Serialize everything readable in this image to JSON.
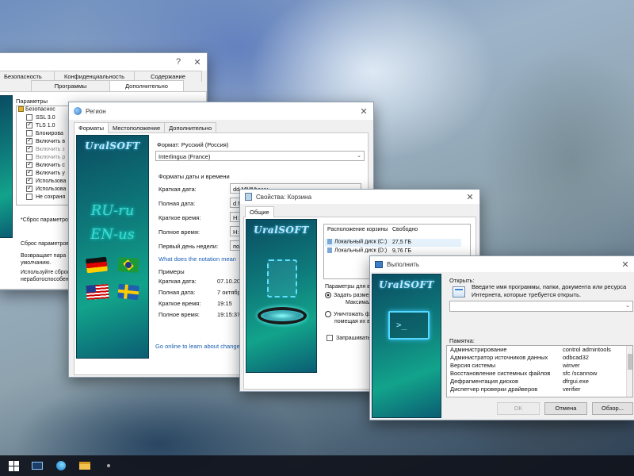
{
  "inet_window": {
    "help": "?",
    "close": "✕",
    "tabs_row1": [
      "Безопасность",
      "Конфиденциальность",
      "Содержание"
    ],
    "tabs_row2": [
      "Программы",
      "Дополнительно"
    ],
    "params_label": "Параметры",
    "tree": [
      {
        "label": "Безопаснос",
        "type": "folder"
      },
      {
        "label": "SSL 3.0",
        "checked": false
      },
      {
        "label": "TLS 1.0",
        "checked": true
      },
      {
        "label": "Блокирова",
        "checked": false
      },
      {
        "label": "Включить в",
        "checked": true
      },
      {
        "label": "Включить з",
        "checked": true
      },
      {
        "label": "Включить р",
        "checked": false
      },
      {
        "label": "Включить с",
        "checked": true
      },
      {
        "label": "Включить у",
        "checked": true
      },
      {
        "label": "Использова",
        "checked": true
      },
      {
        "label": "Использова",
        "checked": true
      },
      {
        "label": "Не сохраня",
        "checked": false
      }
    ],
    "restart_note": "*Сброс параметров",
    "reset_title": "Сброс параметров",
    "reset_desc1": "Возвращает пара",
    "reset_desc2": "умолчанию.",
    "reset_desc3": "Используйте сброс",
    "reset_desc4": "неработоспособен"
  },
  "region_window": {
    "title": "Регион",
    "close": "✕",
    "tabs": [
      "Форматы",
      "Местоположение",
      "Дополнительно"
    ],
    "banner_logo": "UralSOFT",
    "banner_line1": "RU-ru",
    "banner_line2": "EN-us",
    "format_label": "Формат: Русский (Россия)",
    "format_value": "Interlingua (France)",
    "datetime_label": "Форматы даты и времени",
    "rows": [
      {
        "label": "Краткая дата:",
        "value": "dd MMMyyyy"
      },
      {
        "label": "Полная дата:",
        "value": "d M"
      },
      {
        "label": "Краткое время:",
        "value": "H:"
      },
      {
        "label": "Полное время:",
        "value": "H:"
      },
      {
        "label": "Первый день недели:",
        "value": "по"
      }
    ],
    "notation_link": "What does the notation mean",
    "examples_label": "Примеры",
    "examples": [
      {
        "label": "Краткая дата:",
        "value": "07.10.20"
      },
      {
        "label": "Полная дата:",
        "value": "7 октябр"
      },
      {
        "label": "Краткое время:",
        "value": "19:15"
      },
      {
        "label": "Полное время:",
        "value": "19:15:37"
      }
    ],
    "online_link": "Go online to learn about change"
  },
  "recycle_window": {
    "title": "Свойства: Корзина",
    "close": "✕",
    "tabs": [
      "Общие"
    ],
    "banner_logo": "UralSOFT",
    "col_location": "Расположение корзины",
    "col_free": "Свободно",
    "disks": [
      {
        "name": "Локальный диск (C:)",
        "free": "27,5 ГБ"
      },
      {
        "name": "Локальный диск (D:)",
        "free": "9,76 ГБ"
      }
    ],
    "params_label": "Параметры для вы",
    "opt1a": "Задать размер",
    "opt1b": "Максимальн",
    "opt2a": "Уничтожать ф",
    "opt2b": "помещая их в к",
    "confirm_label": "Запрашивать п"
  },
  "run_window": {
    "title": "Выполнить",
    "close": "✕",
    "banner_logo": "UralSOFT",
    "banner_prompt": ">_",
    "open_label": "Открыть:",
    "description": "Введите имя программы, папки, документа или ресурса Интернета, которые требуется открыть.",
    "input_value": "",
    "memo_label": "Памятка:",
    "memo": [
      {
        "name": "Администрирование",
        "cmd": "control admintools"
      },
      {
        "name": "Администратор источников данных",
        "cmd": "odbcad32"
      },
      {
        "name": "Версия системы",
        "cmd": "winver"
      },
      {
        "name": "Восстановление системных файлов",
        "cmd": "sfc /scannow"
      },
      {
        "name": "Дефрагментация дисков",
        "cmd": "dfrgui.exe"
      },
      {
        "name": "Диспетчер проверки драйверов",
        "cmd": "verifier"
      }
    ],
    "ok": "OK",
    "cancel": "Отмена",
    "browse": "Обзор..."
  },
  "taskbar": {
    "items": [
      "windows-start-icon",
      "monitor-icon",
      "edge-icon",
      "file-explorer-icon",
      "store-icon"
    ]
  },
  "colors": {
    "banner_dark": "#0a4c62",
    "banner_light": "#12a38b",
    "link": "#1a5fb4"
  }
}
